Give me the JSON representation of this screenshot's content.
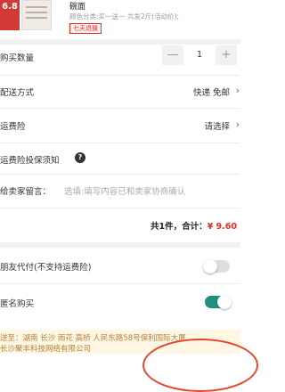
{
  "product": {
    "price_badge": "6.8",
    "title": "碗面",
    "spec": "颜色分类:买一送一 共发2斤(活动价);",
    "tag": "七天退换"
  },
  "quantity": {
    "label": "购买数量",
    "minus": "—",
    "value": "1",
    "plus": "+"
  },
  "delivery": {
    "label": "配送方式",
    "value": "快递 免邮"
  },
  "shipping_insurance": {
    "label": "运费险",
    "value": "请选择"
  },
  "insurance_notice": {
    "label": "运费险投保须知",
    "icon": "question-icon",
    "icon_glyph": "?"
  },
  "message": {
    "label": "给卖家留言：",
    "placeholder": "选填:填写内容已和卖家协商确认"
  },
  "summary": {
    "text": "共1件，合计：",
    "amount": "¥ 9.60"
  },
  "friend_pay": {
    "label": "朋友代付(不支持运费险)",
    "enabled": false
  },
  "anonymous": {
    "label": "匿名购买",
    "enabled": true
  },
  "address": {
    "line1": "送至：湖南 长沙 雨花 高桥 人民东路58号保利国际大厦",
    "line2": "长沙聚丰科技网络有限公司"
  },
  "chevron": "›",
  "colors": {
    "accent_red": "#e02e24",
    "toggle_on": "#1f9080",
    "address_text": "#b8823c"
  }
}
